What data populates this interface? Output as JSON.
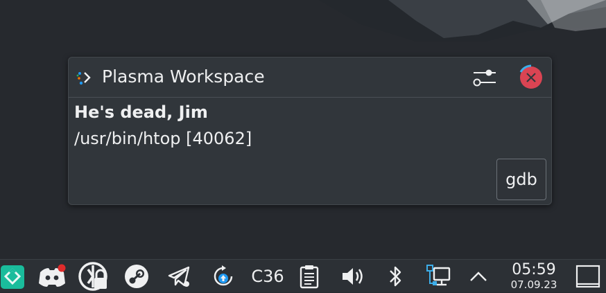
{
  "notification": {
    "app_name": "Plasma Workspace",
    "summary": "He's dead, Jim",
    "body": "/usr/bin/htop [40062]",
    "action_label": "gdb",
    "close_timeout_progress": 0.15
  },
  "taskbar": {
    "tray_text": "C36",
    "clock": {
      "time": "05:59",
      "date": "07.09.23"
    }
  },
  "icons": [
    "app-launcher-icon",
    "discord-icon",
    "keepassxc-icon",
    "steam-icon",
    "telegram-icon",
    "update-icon",
    "clipboard-icon",
    "volume-icon",
    "bluetooth-icon",
    "network-icon",
    "tray-expand-icon",
    "show-desktop-icon",
    "plasma-icon",
    "configure-icon",
    "close-icon"
  ],
  "colors": {
    "close_button": "#da4453",
    "progress_ring": "#3daee9",
    "launcher": "#1abc9c",
    "notification_badge": "#e02b2b"
  }
}
